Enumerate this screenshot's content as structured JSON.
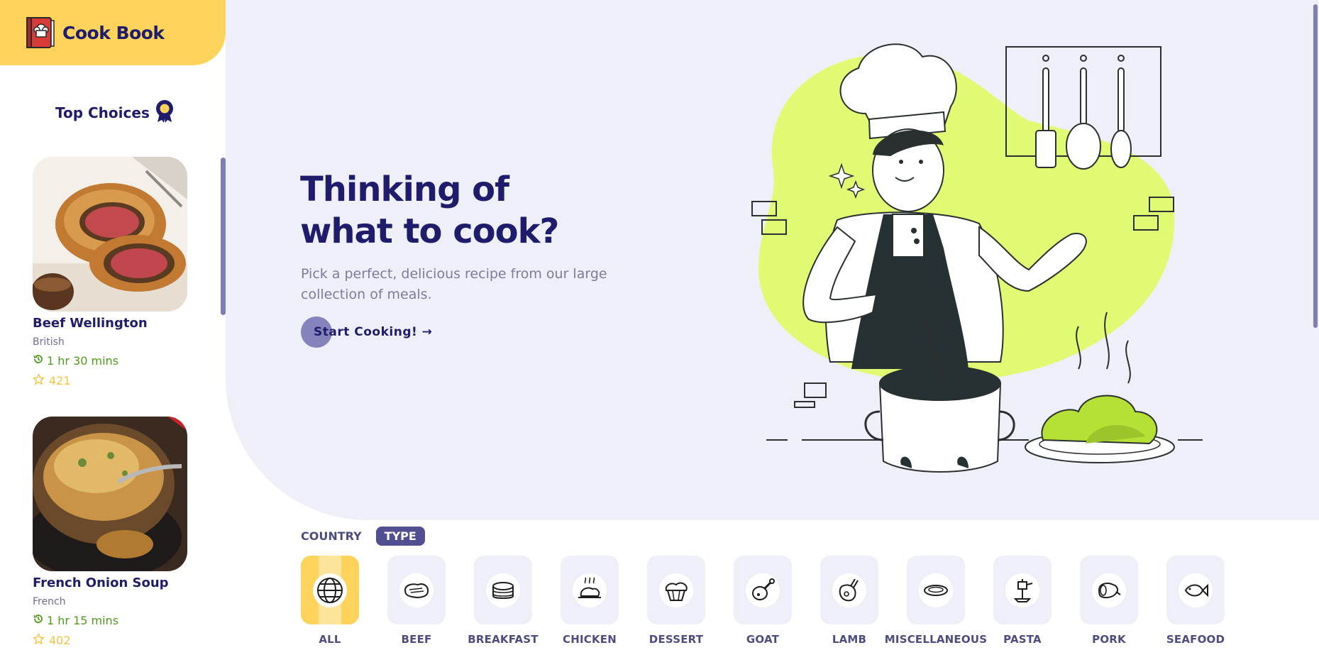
{
  "app": {
    "title": "Cook Book"
  },
  "sidebar": {
    "section_title": "Top Choices",
    "recipes": [
      {
        "name": "Beef Wellington",
        "country": "British",
        "time": "1 hr 30 mins",
        "rating": "421"
      },
      {
        "name": "French Onion Soup",
        "country": "French",
        "time": "1 hr 15 mins",
        "rating": "402"
      }
    ]
  },
  "hero": {
    "title_line1": "Thinking of",
    "title_line2": "what to cook?",
    "subtitle": "Pick a perfect, delicious recipe from our large collection of meals.",
    "cta_label": "Start Cooking! →"
  },
  "filters": {
    "tabs": [
      {
        "label": "COUNTRY",
        "active": false
      },
      {
        "label": "TYPE",
        "active": true
      }
    ]
  },
  "categories": [
    {
      "label": "ALL",
      "icon": "globe-icon",
      "active": true
    },
    {
      "label": "BEEF",
      "icon": "steak-icon",
      "active": false
    },
    {
      "label": "BREAKFAST",
      "icon": "pancakes-icon",
      "active": false
    },
    {
      "label": "CHICKEN",
      "icon": "roast-chicken-icon",
      "active": false
    },
    {
      "label": "DESSERT",
      "icon": "cupcake-icon",
      "active": false
    },
    {
      "label": "GOAT",
      "icon": "drumstick-icon",
      "active": false
    },
    {
      "label": "LAMB",
      "icon": "lamb-chop-icon",
      "active": false
    },
    {
      "label": "MISCELLANEOUS",
      "icon": "plate-icon",
      "active": false
    },
    {
      "label": "PASTA",
      "icon": "pasta-fork-icon",
      "active": false
    },
    {
      "label": "PORK",
      "icon": "ham-icon",
      "active": false
    },
    {
      "label": "SEAFOOD",
      "icon": "fish-icon",
      "active": false
    }
  ],
  "colors": {
    "brand_yellow": "#fdd35c",
    "navy": "#1f1d6b",
    "hero_bg": "#eeeff8",
    "lime": "#e1fa74",
    "accent_purple": "#524f93",
    "time_green": "#4f9b1a",
    "star_yellow": "#f5c542"
  }
}
